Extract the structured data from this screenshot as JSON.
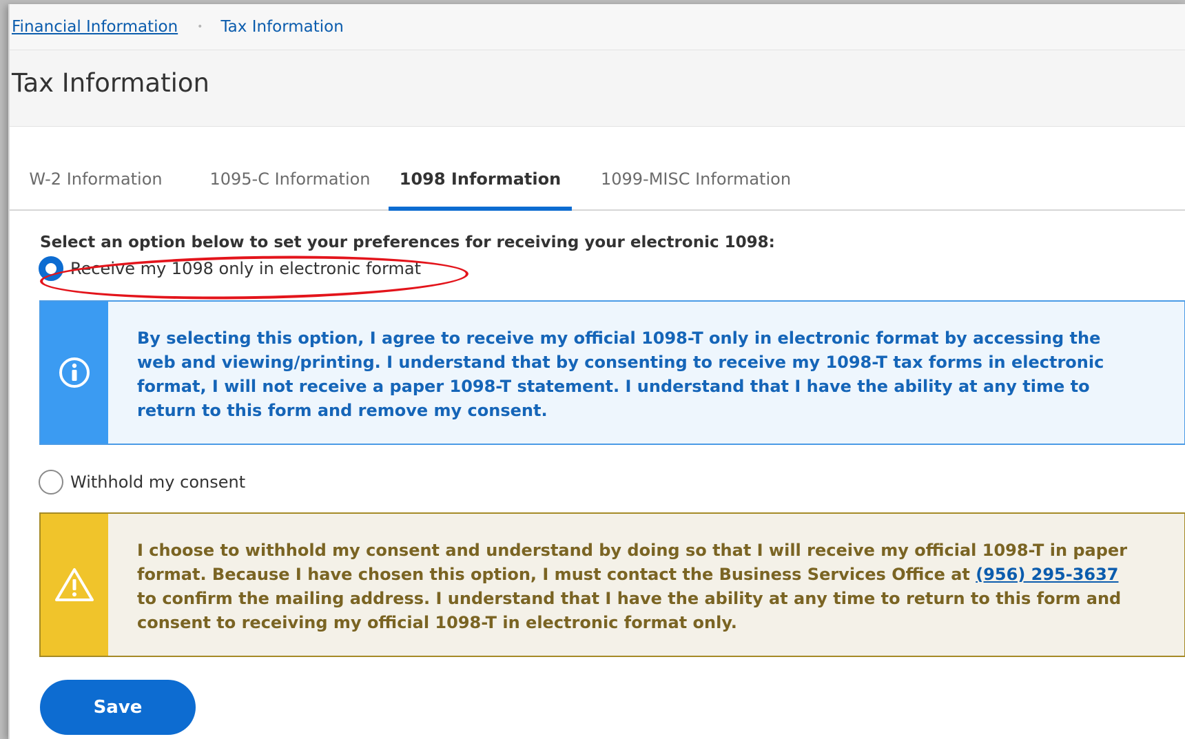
{
  "breadcrumb": {
    "parent": "Financial Information",
    "separator": "•",
    "current": "Tax Information"
  },
  "header": {
    "title": "Tax Information"
  },
  "tabs": [
    {
      "label": "W-2 Information",
      "active": false
    },
    {
      "label": "1095-C Information",
      "active": false
    },
    {
      "label": "1098 Information",
      "active": true
    },
    {
      "label": "1099-MISC Information",
      "active": false
    }
  ],
  "form": {
    "prompt": "Select an option below to set your preferences for receiving your electronic 1098:",
    "options": [
      {
        "label": "Receive my 1098 only in electronic format",
        "selected": true,
        "alert_type": "info",
        "alert_icon": "info-circle-icon",
        "alert_text": "By selecting this option, I agree to receive my official 1098-T only in electronic format by accessing the web and viewing/printing. I understand that by consenting to receive my 1098-T tax forms in electronic format, I will not receive a paper 1098-T statement. I understand that I have the ability at any time to return to this form and remove my consent."
      },
      {
        "label": "Withhold my consent",
        "selected": false,
        "alert_type": "warning",
        "alert_icon": "warning-triangle-icon",
        "alert_text_before": "I choose to withhold my consent and understand by doing so that I will receive my official 1098-T in paper format. Because I have chosen this option, I must contact the Business Services Office at ",
        "phone": "(956) 295-3637",
        "alert_text_after": " to confirm the mailing address. I understand that I have the ability at any time to return to this form and consent to receiving my official 1098-T in electronic format only."
      }
    ],
    "save_label": "Save"
  },
  "colors": {
    "primary": "#0d6cd1",
    "info_side": "#3b9bf2",
    "warning_side": "#f0c42b",
    "annotation": "#e3141b"
  }
}
